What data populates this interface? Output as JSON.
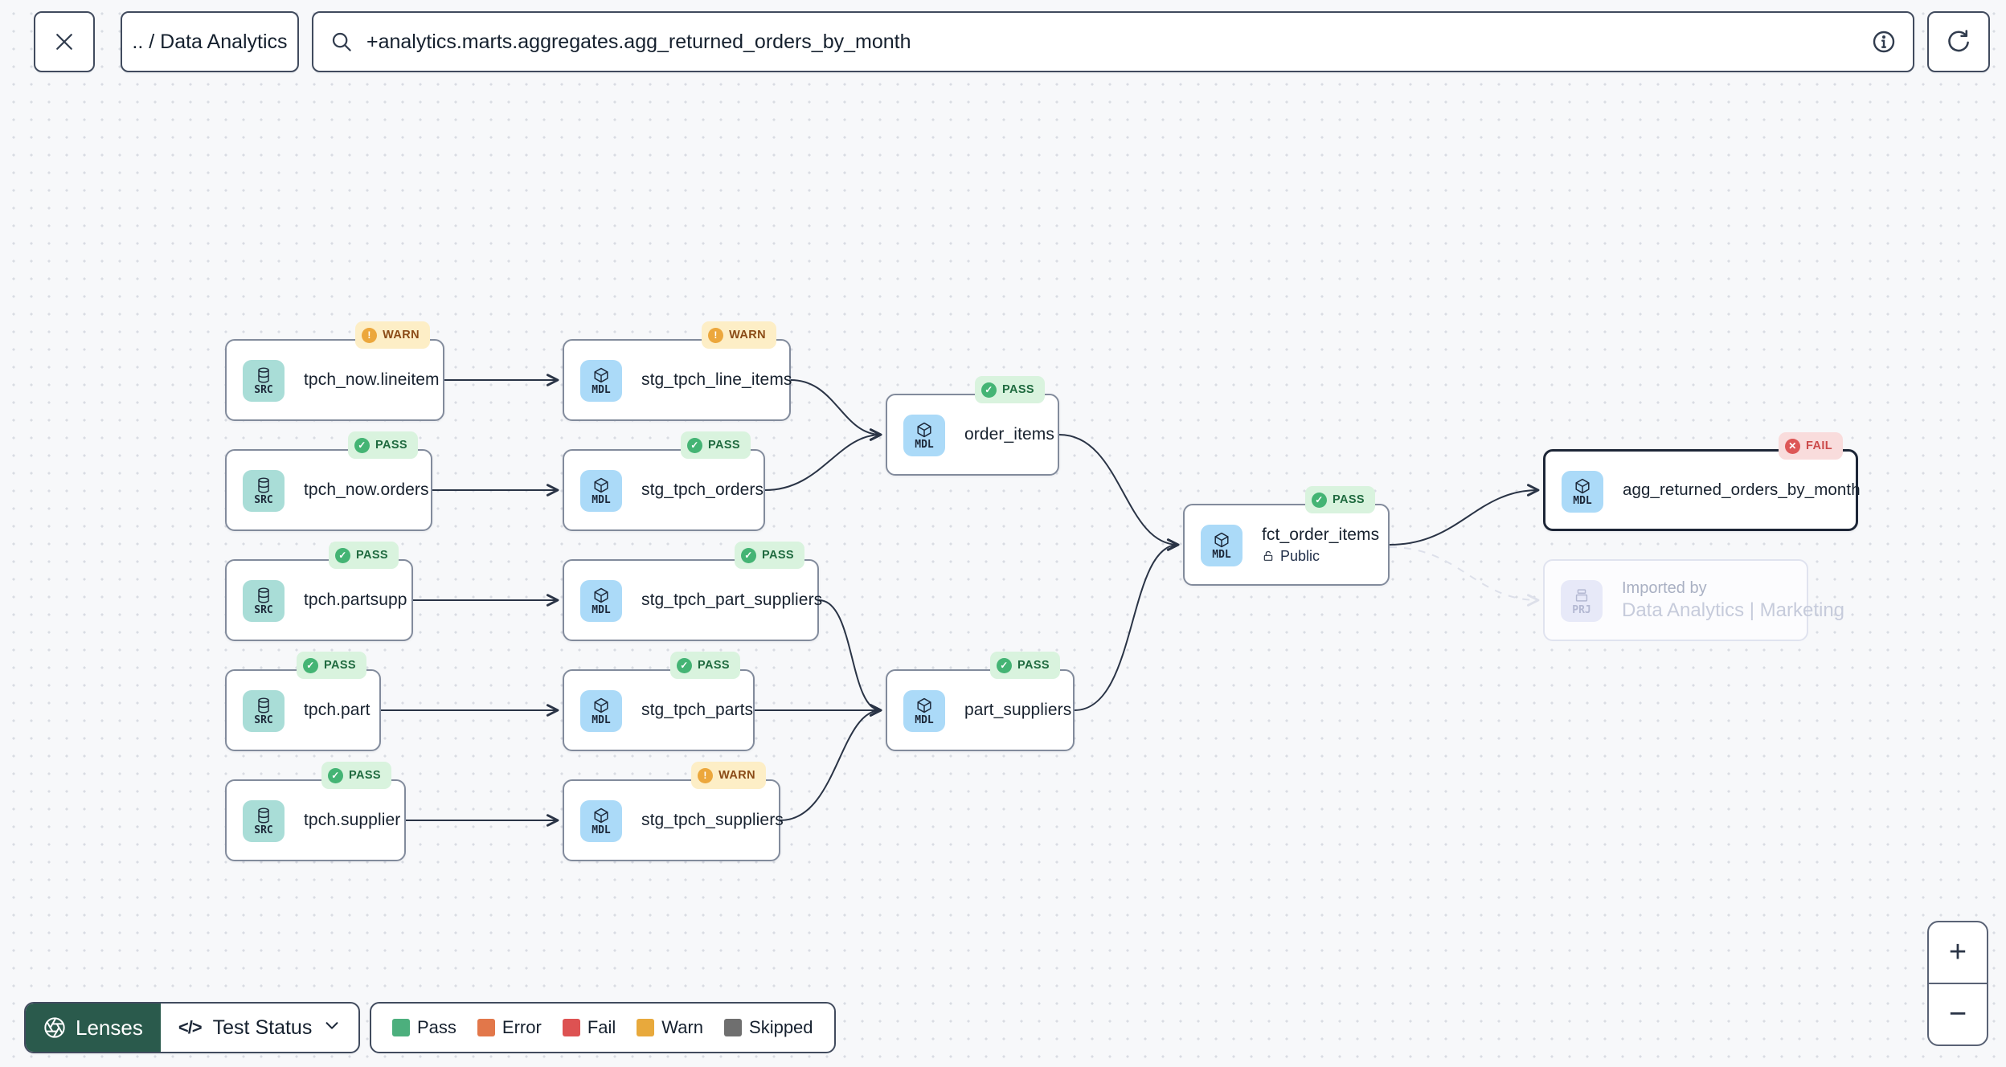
{
  "topbar": {
    "breadcrumb": ".. / Data Analytics",
    "search": {
      "value": "+analytics.marts.aggregates.agg_returned_orders_by_month"
    }
  },
  "icons": {
    "close": "close-icon",
    "search": "magnifier",
    "info": "info-circle",
    "refresh": "refresh-arrow",
    "lenses": "aperture",
    "code": "</>",
    "chevron": "chevron-down",
    "zoom_in": "+",
    "zoom_out": "−"
  },
  "badge_glyphs": {
    "pass": "✓",
    "warn": "!",
    "fail": "✕"
  },
  "lenses": {
    "label": "Lenses",
    "selected": "Test Status"
  },
  "legend": {
    "items": [
      {
        "label": "Pass",
        "color": "#4caf7d"
      },
      {
        "label": "Error",
        "color": "#e2774a"
      },
      {
        "label": "Fail",
        "color": "#dd5252"
      },
      {
        "label": "Warn",
        "color": "#e8a93c"
      },
      {
        "label": "Skipped",
        "color": "#6f6f6f"
      }
    ]
  },
  "nodes": [
    {
      "id": "tpch_now.lineitem",
      "label": "tpch_now.lineitem",
      "type": "SRC",
      "status": "WARN"
    },
    {
      "id": "stg_tpch_line_items",
      "label": "stg_tpch_line_items",
      "type": "MDL",
      "status": "WARN"
    },
    {
      "id": "tpch_now.orders",
      "label": "tpch_now.orders",
      "type": "SRC",
      "status": "PASS"
    },
    {
      "id": "stg_tpch_orders",
      "label": "stg_tpch_orders",
      "type": "MDL",
      "status": "PASS"
    },
    {
      "id": "tpch.partsupp",
      "label": "tpch.partsupp",
      "type": "SRC",
      "status": "PASS"
    },
    {
      "id": "stg_tpch_part_suppliers",
      "label": "stg_tpch_part_suppliers",
      "type": "MDL",
      "status": "PASS"
    },
    {
      "id": "tpch.part",
      "label": "tpch.part",
      "type": "SRC",
      "status": "PASS"
    },
    {
      "id": "stg_tpch_parts",
      "label": "stg_tpch_parts",
      "type": "MDL",
      "status": "PASS"
    },
    {
      "id": "tpch.supplier",
      "label": "tpch.supplier",
      "type": "SRC",
      "status": "PASS"
    },
    {
      "id": "stg_tpch_suppliers",
      "label": "stg_tpch_suppliers",
      "type": "MDL",
      "status": "WARN"
    },
    {
      "id": "order_items",
      "label": "order_items",
      "type": "MDL",
      "status": "PASS"
    },
    {
      "id": "part_suppliers",
      "label": "part_suppliers",
      "type": "MDL",
      "status": "PASS"
    },
    {
      "id": "fct_order_items",
      "label": "fct_order_items",
      "type": "MDL",
      "status": "PASS",
      "visibility": "Public"
    },
    {
      "id": "agg_returned_orders_by_month",
      "label": "agg_returned_orders_by_month",
      "type": "MDL",
      "status": "FAIL",
      "selected": true
    },
    {
      "id": "imported_by_project",
      "title": "Imported by",
      "label": "Data Analytics | Marketing",
      "type": "PRJ",
      "faded": true
    }
  ],
  "edges": [
    {
      "from": "tpch_now.lineitem",
      "to": "stg_tpch_line_items",
      "style": "solid"
    },
    {
      "from": "tpch_now.orders",
      "to": "stg_tpch_orders",
      "style": "solid"
    },
    {
      "from": "tpch.partsupp",
      "to": "stg_tpch_part_suppliers",
      "style": "solid"
    },
    {
      "from": "tpch.part",
      "to": "stg_tpch_parts",
      "style": "solid"
    },
    {
      "from": "tpch.supplier",
      "to": "stg_tpch_suppliers",
      "style": "solid"
    },
    {
      "from": "stg_tpch_line_items",
      "to": "order_items",
      "style": "solid"
    },
    {
      "from": "stg_tpch_orders",
      "to": "order_items",
      "style": "solid"
    },
    {
      "from": "order_items",
      "to": "fct_order_items",
      "style": "solid"
    },
    {
      "from": "stg_tpch_part_suppliers",
      "to": "part_suppliers",
      "style": "solid"
    },
    {
      "from": "stg_tpch_parts",
      "to": "part_suppliers",
      "style": "solid"
    },
    {
      "from": "stg_tpch_suppliers",
      "to": "part_suppliers",
      "style": "solid"
    },
    {
      "from": "part_suppliers",
      "to": "fct_order_items",
      "style": "solid"
    },
    {
      "from": "fct_order_items",
      "to": "agg_returned_orders_by_month",
      "style": "solid"
    },
    {
      "from": "fct_order_items",
      "to": "imported_by_project",
      "style": "dashed"
    }
  ]
}
